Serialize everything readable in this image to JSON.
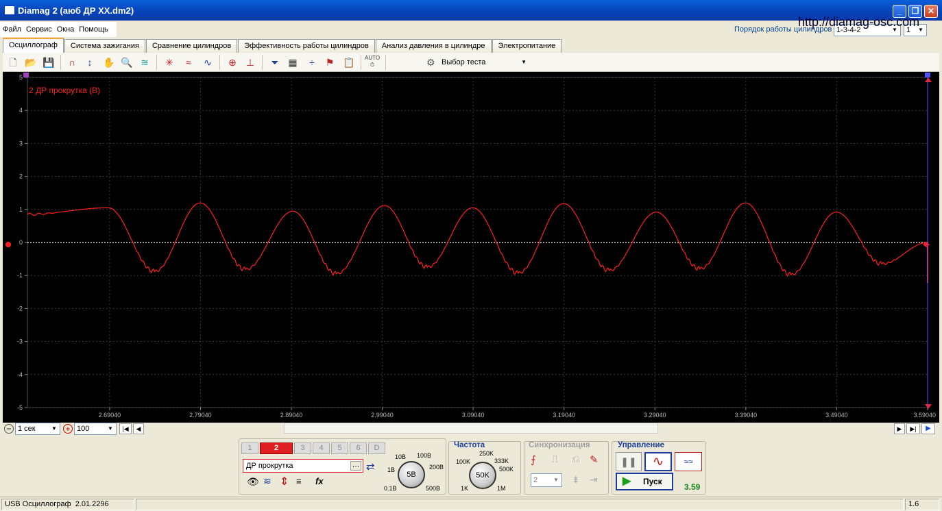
{
  "window": {
    "title": "Diamag 2 (аюб ДР ХХ.dm2)"
  },
  "menu": [
    "Файл",
    "Сервис",
    "Окна",
    "Помощь"
  ],
  "url": "http://diamag-osc.com",
  "firing_order": {
    "label": "Порядок работы цилиндров",
    "value": "1-3-4-2",
    "cylinder": "1"
  },
  "tabs": [
    "Осциллограф",
    "Система зажигания",
    "Сравнение цилиндров",
    "Эффективность работы цилиндров",
    "Анализ давления в цилиндре",
    "Электропитание"
  ],
  "active_tab": 0,
  "toolbar": {
    "test_select": "Выбор теста",
    "auto_label": "AUTO"
  },
  "chart_data": {
    "type": "line",
    "title": "2 ДР прокрутка (В)",
    "ylim": [
      -5,
      5
    ],
    "yticks": [
      "5",
      "4",
      "3",
      "2",
      "1",
      "0",
      "-1",
      "-2",
      "-3",
      "-4",
      "-5"
    ],
    "xlim": [
      2.6,
      3.5904
    ],
    "xticks": [
      "2.69040",
      "2.79040",
      "2.89040",
      "2.99040",
      "3.09040",
      "3.19040",
      "3.29040",
      "3.39040",
      "3.49040",
      "3.59040"
    ],
    "xtick_values": [
      2.6904,
      2.7904,
      2.8904,
      2.9904,
      3.0904,
      3.1904,
      3.2904,
      3.3904,
      3.4904,
      3.5904
    ],
    "series": [
      {
        "color": "#ff2020",
        "peaks_x": [
          2.689,
          2.79,
          2.892,
          2.993,
          3.09,
          3.19,
          3.292,
          3.39,
          3.49
        ],
        "peaks_y": [
          1.05,
          1.2,
          0.95,
          1.12,
          1.05,
          1.18,
          0.92,
          1.2,
          0.92
        ],
        "troughs_x": [
          2.74,
          2.84,
          2.94,
          3.04,
          3.14,
          3.24,
          3.34,
          3.44,
          3.54
        ],
        "troughs_y": [
          -0.88,
          -0.82,
          -0.95,
          -0.75,
          -0.93,
          -0.85,
          -0.8,
          -0.98,
          -0.65
        ]
      }
    ]
  },
  "timebase": {
    "value": "1 сек",
    "zoom": "100"
  },
  "channels": {
    "buttons": [
      "1",
      "2",
      "3",
      "4",
      "5",
      "6",
      "D"
    ],
    "active": "2",
    "name": "ДР прокрутка"
  },
  "voltage": {
    "value": "5В",
    "labels": [
      "10В",
      "100В",
      "1В",
      "200В",
      "0.1В",
      "500В"
    ]
  },
  "frequency": {
    "title": "Частота",
    "value": "50K",
    "labels": [
      "250K",
      "100K",
      "333K",
      "500K",
      "1K",
      "1M"
    ]
  },
  "sync": {
    "title": "Синхронизация",
    "channel": "2"
  },
  "control": {
    "title": "Управление",
    "start": "Пуск",
    "value": "3.59"
  },
  "status": {
    "device": "USB Осциллограф",
    "version": "2.01.2296",
    "right": "1.6"
  }
}
